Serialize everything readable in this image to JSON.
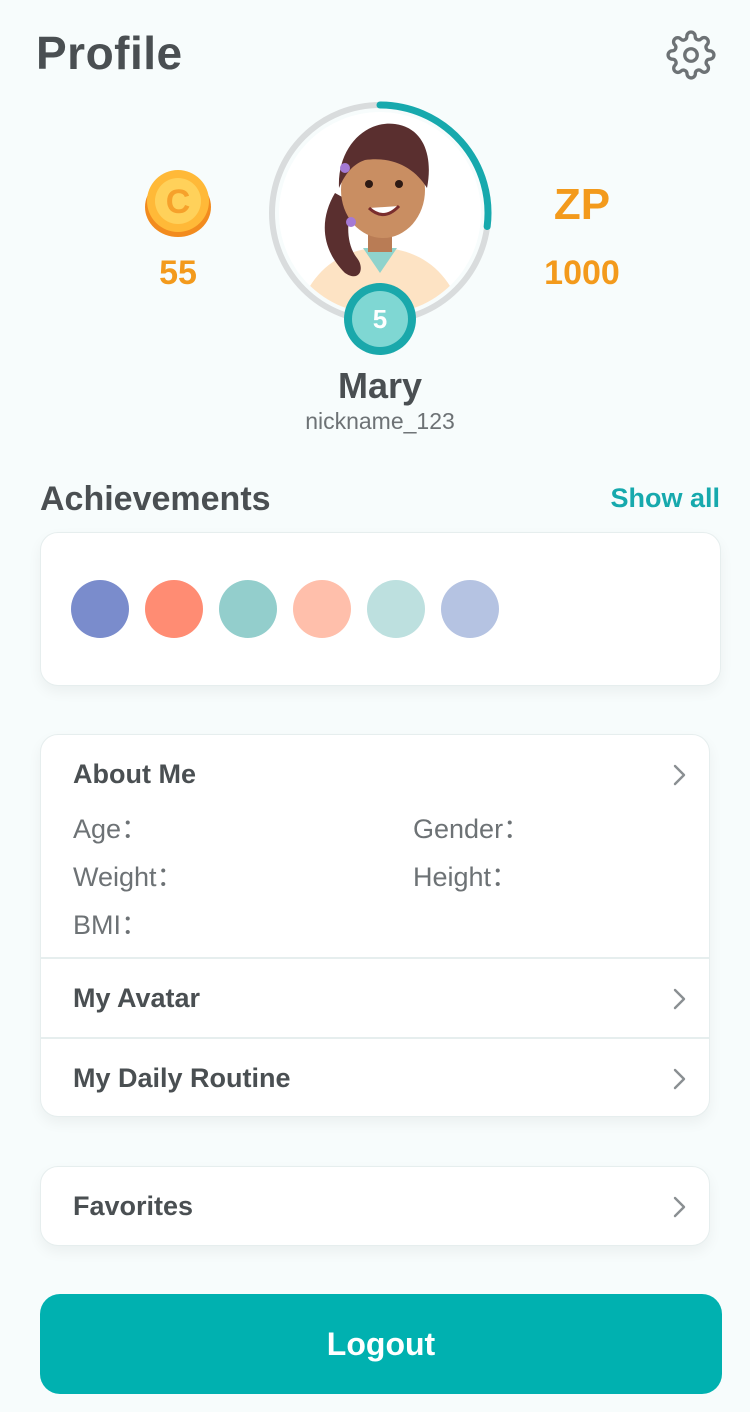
{
  "header": {
    "title": "Profile",
    "settings_icon": "gear-icon"
  },
  "stats": {
    "coin_icon": "coin-icon",
    "coin_letter": "C",
    "coins": "55",
    "zp_label": "ZP",
    "zp_value": "1000"
  },
  "user": {
    "name": "Mary",
    "nickname": "nickname_123",
    "level": "5",
    "level_progress": 0.27
  },
  "achievements": {
    "title": "Achievements",
    "show_all": "Show all",
    "badges": [
      "#7a8ccc",
      "#ff8c73",
      "#93cecc",
      "#ffbfab",
      "#bde0df",
      "#b5c3e2"
    ]
  },
  "about": {
    "title": "About Me",
    "age_label": "Age：",
    "gender_label": "Gender：",
    "weight_label": "Weight：",
    "height_label": "Height：",
    "bmi_label": "BMI："
  },
  "menu": {
    "avatar": "My Avatar",
    "routine": "My Daily Routine",
    "favorites": "Favorites"
  },
  "logout": "Logout",
  "colors": {
    "accent": "#00b1b0",
    "orange": "#f39a1c",
    "text": "#4a4f52"
  }
}
